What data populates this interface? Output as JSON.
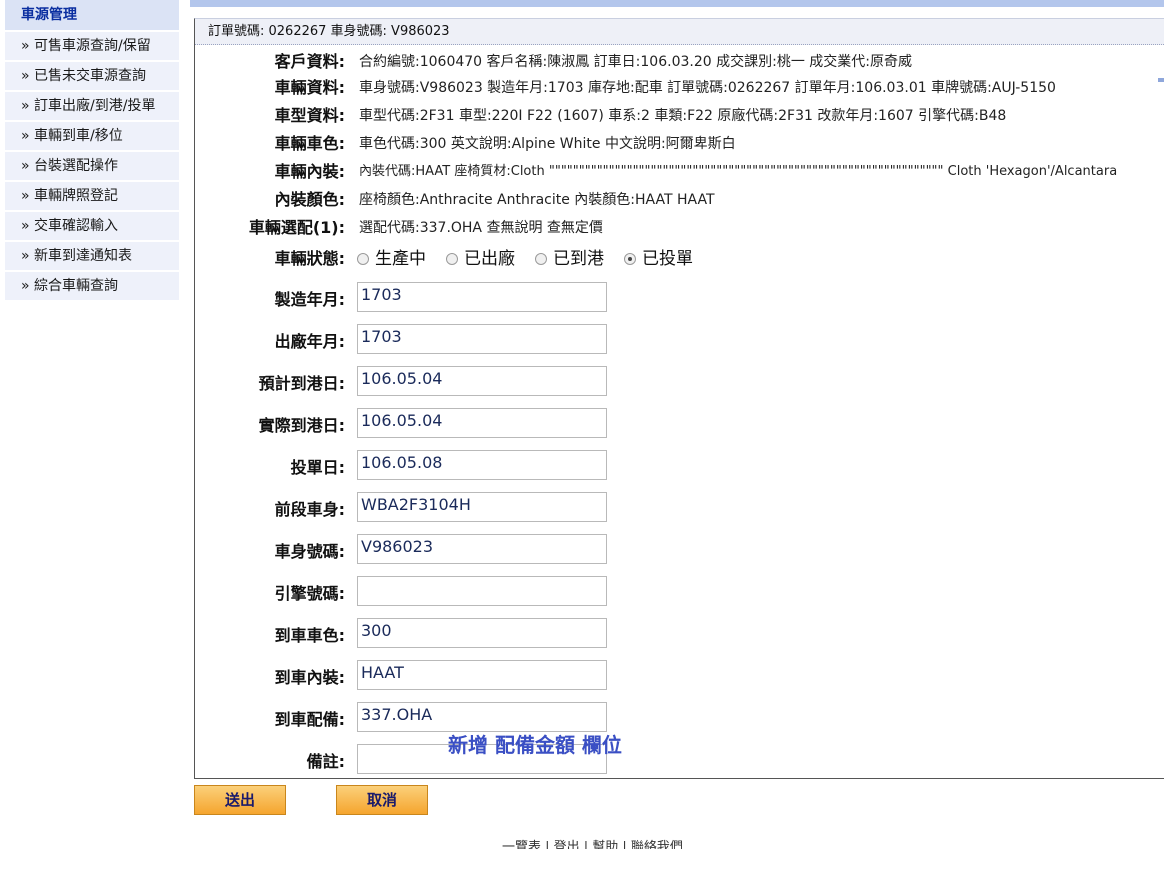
{
  "sidebar": {
    "title": "車源管理",
    "items": [
      {
        "label": "» 可售車源查詢/保留"
      },
      {
        "label": "» 已售未交車源查詢"
      },
      {
        "label": "» 訂車出廠/到港/投單"
      },
      {
        "label": "» 車輛到車/移位"
      },
      {
        "label": "» 台裝選配操作"
      },
      {
        "label": "» 車輛牌照登記"
      },
      {
        "label": "» 交車確認輸入"
      },
      {
        "label": "» 新車到達通知表"
      },
      {
        "label": "» 綜合車輛查詢"
      }
    ]
  },
  "header": {
    "text": "訂單號碼: 0262267  車身號碼: V986023"
  },
  "info": [
    {
      "label": "客戶資料:",
      "value": "合約編號:1060470   客戶名稱:陳淑鳳   訂車日:106.03.20   成交課別:桃一   成交業代:原奇威"
    },
    {
      "label": "車輛資料:",
      "value": "車身號碼:V986023   製造年月:1703   庫存地:配車   訂單號碼:0262267   訂單年月:106.03.01   車牌號碼:AUJ-5150"
    },
    {
      "label": "車型資料:",
      "value": "車型代碼:2F31   車型:220I F22 (1607)   車系:2   車類:F22   原廠代碼:2F31   改款年月:1607   引擎代碼:B48"
    },
    {
      "label": "車輛車色:",
      "value": "車色代碼:300   英文說明:Alpine White   中文說明:阿爾卑斯白"
    },
    {
      "label": "車輛內裝:",
      "value": "內裝代碼:HAAT   座椅質材:Cloth \"\"\"\"\"\"\"\"\"\"\"\"\"\"\"\"\"\"\"\"\"\"\"\"\"\"\"\"\"\"\"\"\"\"\"\"\"\"\"\"\"\"\"\"\"\"\"\"\"\"\"\"\"\"\"\"\"\"\"\"\"\"\"\"\"\"   Cloth 'Hexagon'/Alcantara"
    },
    {
      "label": "內裝顏色:",
      "value": "座椅顏色:Anthracite   Anthracite   內裝顏色:HAAT   HAAT"
    },
    {
      "label": "車輛選配(1):",
      "value": "選配代碼:337.OHA   查無說明   查無定價"
    }
  ],
  "status": {
    "label": "車輛狀態:",
    "options": [
      "生產中",
      "已出廠",
      "已到港",
      "已投單"
    ],
    "selected": "已投單"
  },
  "fields": [
    {
      "label": "製造年月:",
      "value": "1703"
    },
    {
      "label": "出廠年月:",
      "value": "1703"
    },
    {
      "label": "預計到港日:",
      "value": "106.05.04"
    },
    {
      "label": "實際到港日:",
      "value": "106.05.04"
    },
    {
      "label": "投單日:",
      "value": "106.05.08"
    },
    {
      "label": "前段車身:",
      "value": "WBA2F3104H"
    },
    {
      "label": "車身號碼:",
      "value": "V986023"
    },
    {
      "label": "引擎號碼:",
      "value": ""
    },
    {
      "label": "到車車色:",
      "value": "300"
    },
    {
      "label": "到車內裝:",
      "value": "HAAT"
    },
    {
      "label": "到車配備:",
      "value": "337.OHA"
    },
    {
      "label": "備註:",
      "value": ""
    }
  ],
  "annotation": "新增 配備金額 欄位",
  "buttons": {
    "submit": "送出",
    "cancel": "取消"
  },
  "footer": "一覽表 | 登出 | 幫助 | 聯絡我們"
}
